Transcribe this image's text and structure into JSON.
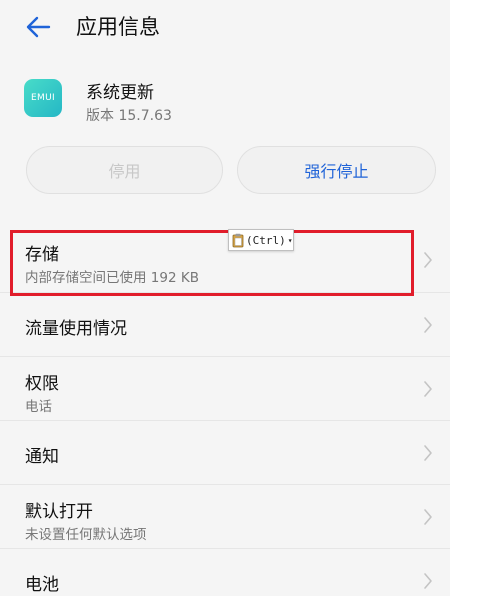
{
  "header": {
    "title": "应用信息"
  },
  "app": {
    "icon_text": "EMUI",
    "name": "系统更新",
    "version": "版本 15.7.63"
  },
  "buttons": {
    "stop": "停用",
    "force_stop": "强行停止"
  },
  "list": [
    {
      "title": "存储",
      "subtitle": "内部存储空间已使用 192 KB"
    },
    {
      "title": "流量使用情况",
      "subtitle": ""
    },
    {
      "title": "权限",
      "subtitle": "电话"
    },
    {
      "title": "通知",
      "subtitle": ""
    },
    {
      "title": "默认打开",
      "subtitle": "未设置任何默认选项"
    },
    {
      "title": "电池",
      "subtitle": ""
    }
  ],
  "paste_popup": {
    "label": "(Ctrl)"
  },
  "colors": {
    "accent": "#1f63d8",
    "highlight": "#e11d2b",
    "icon_gradient_start": "#48dcc9",
    "icon_gradient_end": "#25b7c5"
  }
}
